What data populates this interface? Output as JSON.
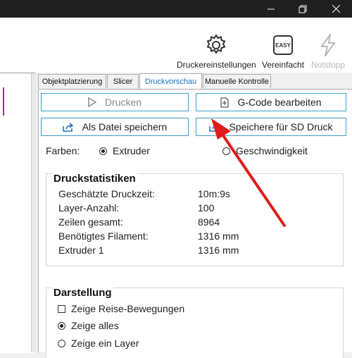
{
  "window": {
    "controls": [
      "minimize",
      "maximize",
      "close"
    ]
  },
  "toolbar": {
    "printer_settings_label": "Druckereinstellungen",
    "simplified_label": "Vereinfacht",
    "simplified_icon_text": "EASY",
    "emergency_stop_label": "Notstopp"
  },
  "tabs": [
    {
      "label": "Objektplatzierung",
      "active": false
    },
    {
      "label": "Slicer",
      "active": false
    },
    {
      "label": "Druckvorschau",
      "active": true
    },
    {
      "label": "Manuelle Kontrolle",
      "active": false
    }
  ],
  "actions": {
    "print_label": "Drucken",
    "edit_gcode_label": "G-Code bearbeiten",
    "save_file_label": "Als Datei speichern",
    "save_sd_label": "Speichere für SD Druck"
  },
  "colors": {
    "label": "Farben:",
    "options": [
      "Extruder",
      "Geschwindigkeit"
    ],
    "selected": "Extruder"
  },
  "stats": {
    "title": "Druckstatistiken",
    "rows": [
      {
        "key": "Geschätzte Druckzeit:",
        "value": "10m:9s"
      },
      {
        "key": "Layer-Anzahl:",
        "value": "100"
      },
      {
        "key": "Zeilen gesamt:",
        "value": "8964"
      },
      {
        "key": "Benötigtes Filament:",
        "value": "1316 mm"
      },
      {
        "key": "Extruder 1",
        "value": "1316 mm"
      }
    ]
  },
  "display": {
    "title": "Darstellung",
    "show_travel_label": "Zeige Reise-Bewegungen",
    "show_all_label": "Zeige alles",
    "show_one_layer_label": "Zeige ein Layer"
  },
  "accent_colors": {
    "button_border": "#3aa0c9",
    "active_tab": "#1a72c2",
    "annotation_arrow": "#e01b1b"
  }
}
